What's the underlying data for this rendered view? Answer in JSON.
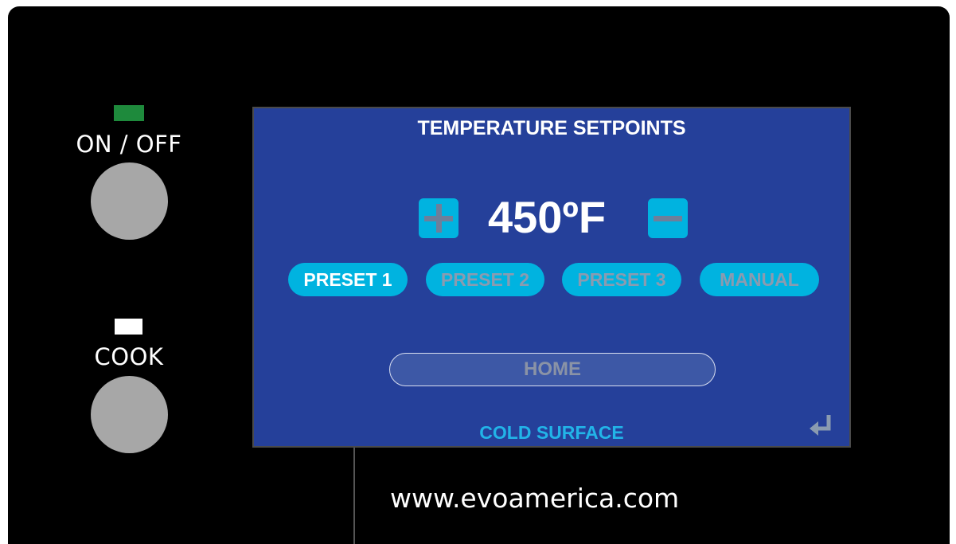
{
  "controls": {
    "power": {
      "label": "ON / OFF",
      "indicator_color": "#1e8a3c"
    },
    "cook": {
      "label": "COOK",
      "indicator_color": "#ffffff"
    }
  },
  "screen": {
    "title": "TEMPERATURE SETPOINTS",
    "temperature": "450ºF",
    "increase_icon": "plus-icon",
    "decrease_icon": "minus-icon",
    "presets": [
      {
        "label": "PRESET 1",
        "selected": true
      },
      {
        "label": "PRESET 2",
        "selected": false
      },
      {
        "label": "PRESET 3",
        "selected": false
      },
      {
        "label": "MANUAL",
        "selected": false
      }
    ],
    "home_label": "HOME",
    "status": "COLD SURFACE",
    "return_icon": "return-arrow-icon",
    "background_color": "#25409a",
    "accent_color": "#00b3e0"
  },
  "footer": {
    "url": "www.evoamerica.com"
  }
}
